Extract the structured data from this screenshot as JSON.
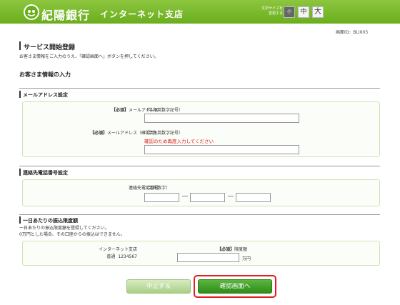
{
  "header": {
    "bank_name": "紀陽銀行",
    "branch_name": "インターネット支店",
    "fontsize_caption_1": "文字サイズを",
    "fontsize_caption_2": "変更する",
    "fontsize_small": "小",
    "fontsize_mid": "中",
    "fontsize_large": "大"
  },
  "screen_id": "画面ID：BLI003",
  "page": {
    "title": "サービス開始登録",
    "description": "お客さま情報をご入力のうえ、「確認画面へ」ボタンを押してください。"
  },
  "customer_section": {
    "title": "お客さま情報の入力"
  },
  "email": {
    "title": "メールアドレス設定",
    "required": "【必須】",
    "label": "メールアドレス",
    "hint": "（半角英数字記号）",
    "confirm_label": "メールアドレス（確認用）",
    "confirm_hint": "（半角英数字記号）",
    "confirm_warning": "確認のため再度入力してください",
    "value": "",
    "confirm_value": ""
  },
  "phone": {
    "title": "連絡先電話番号設定",
    "label": "連絡先電話番号",
    "hint": "（半角数字）",
    "dash": "―",
    "part1": "",
    "part2": "",
    "part3": ""
  },
  "limit": {
    "title": "一日あたりの振込限度額",
    "desc1": "一日あたりの振込限度額を登録してください。",
    "desc2": "0万円とした場合、その口座からの振込はできません。",
    "account_branch": "インターネット支店",
    "account_type": "普通",
    "account_number": "1234567",
    "required": "【必須】",
    "label": "限度額",
    "unit": "万円",
    "value": ""
  },
  "buttons": {
    "cancel": "中止する",
    "confirm": "確認画面へ"
  },
  "colors": {
    "header_green": "#6aae1e",
    "warning_red": "#e02020",
    "confirm_green": "#2f8d1a"
  }
}
